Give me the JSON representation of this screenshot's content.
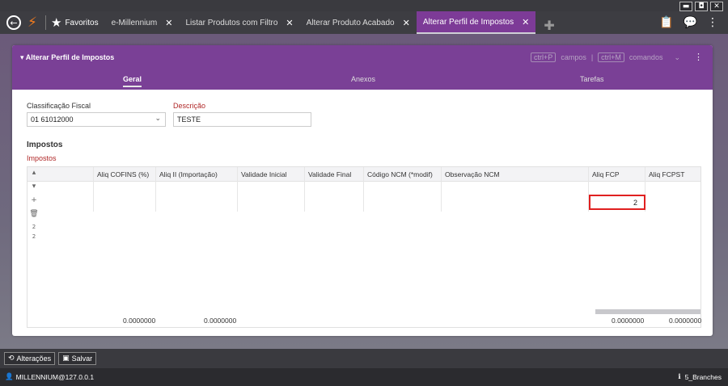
{
  "window": {
    "minimize": "▬",
    "maximize": "◘",
    "close": "✕"
  },
  "topbar": {
    "favorites_label": "Favoritos",
    "tabs": [
      {
        "label": "e-Millennium",
        "active": false
      },
      {
        "label": "Listar Produtos com Filtro",
        "active": false
      },
      {
        "label": "Alterar Produto Acabado",
        "active": false
      },
      {
        "label": "Alterar Perfil de Impostos",
        "active": true
      }
    ]
  },
  "panel": {
    "title": "Alterar Perfil de Impostos",
    "hint_fields_key": "ctrl+P",
    "hint_fields_label": "campos",
    "hint_divider": "|",
    "hint_commands_key": "ctrl+M",
    "hint_commands_label": "comandos",
    "subtabs": [
      "Geral",
      "Anexos",
      "Tarefas"
    ],
    "active_subtab": "Geral"
  },
  "form": {
    "classificacao_label": "Classificação Fiscal",
    "classificacao_value": "01 61012000",
    "descricao_label": "Descrição",
    "descricao_value": "TESTE"
  },
  "impostos": {
    "section_title": "Impostos",
    "grid_label": "Impostos",
    "columns": [
      "Aliq COFINS (%)",
      "Aliq II (Importação)",
      "Validade Inicial",
      "Validade Final",
      "Código NCM (*modif)",
      "Observação NCM",
      "Aliq FCP",
      "Aliq FCPST"
    ],
    "editing_value": "2",
    "side_counts": [
      "2",
      "2"
    ],
    "totals": {
      "cofins": "0.0000000",
      "ii": "0.0000000",
      "fcp": "0.0000000",
      "fcpst": "0.0000000"
    }
  },
  "bottom": {
    "alteracoes_label": "Alterações",
    "salvar_label": "Salvar"
  },
  "status": {
    "user": "MILLENNIUM@127.0.0.1",
    "branch": "5_Branches"
  }
}
